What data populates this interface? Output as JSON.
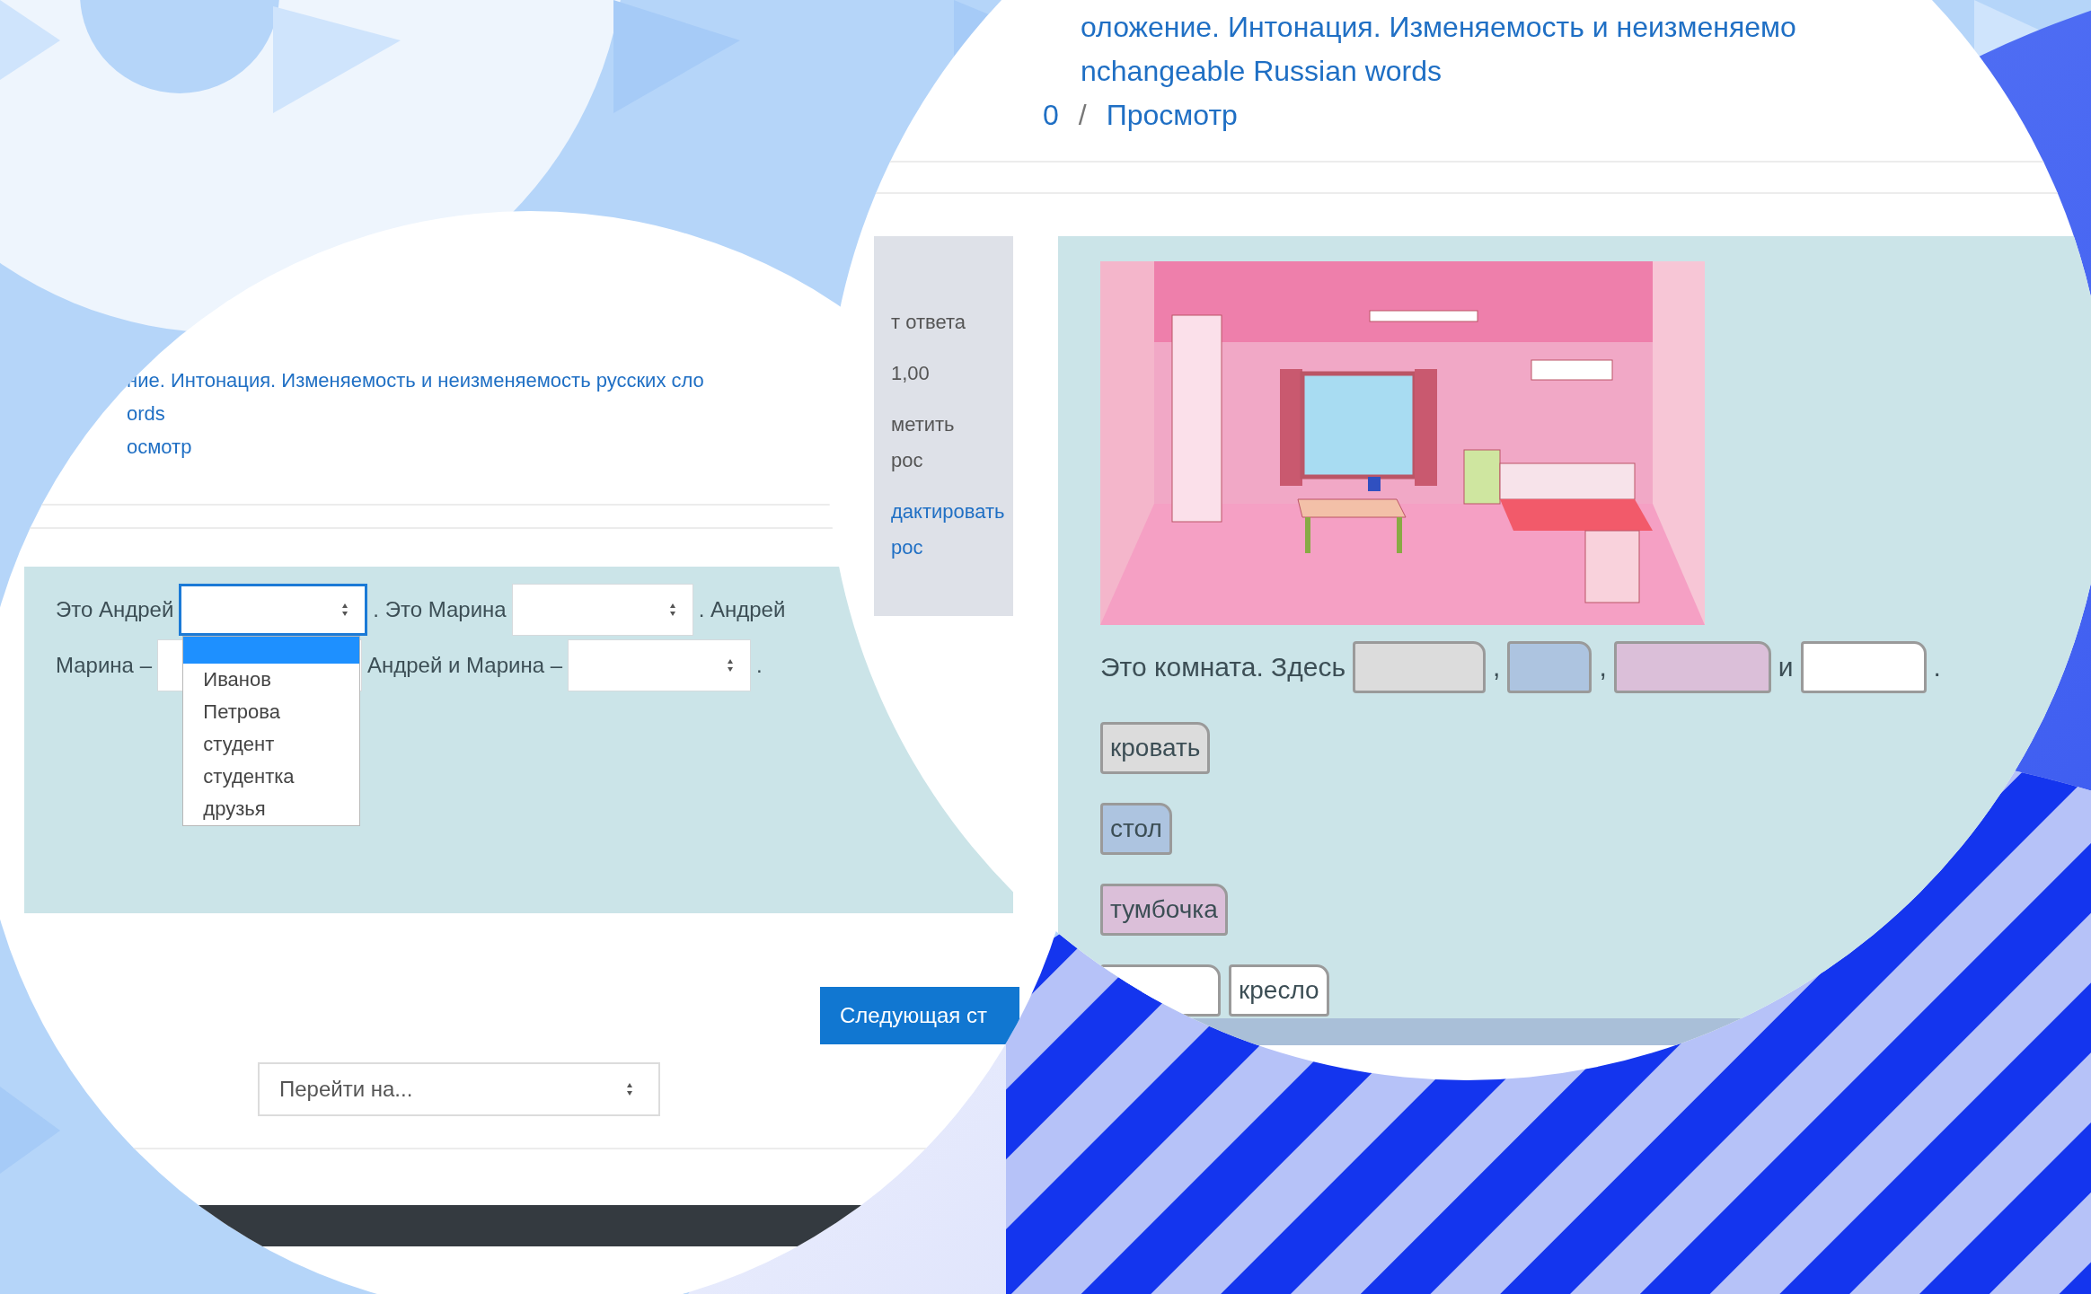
{
  "left_screen": {
    "breadcrumb": [
      "ние. Интонация. Изменяемость и неизменяемость русских сло",
      "ords",
      "осмотр"
    ],
    "question": [
      [
        {
          "kind": "text",
          "text": "Это Андрей"
        },
        {
          "kind": "select",
          "open": true
        },
        {
          "kind": "text",
          "text": ". Это Марина"
        },
        {
          "kind": "select",
          "open": false
        },
        {
          "kind": "text",
          "text": ". Андрей"
        }
      ],
      [
        {
          "kind": "text",
          "text": "Марина –"
        },
        {
          "kind": "select",
          "open": false
        },
        {
          "kind": "text",
          "text": "Андрей и Марина –"
        },
        {
          "kind": "select",
          "open": false
        },
        {
          "kind": "text",
          "text": "."
        }
      ]
    ],
    "dropdown": {
      "blank_option_highlighted": true,
      "options": [
        "Иванов",
        "Петрова",
        "студент",
        "студентка",
        "друзья"
      ]
    },
    "next_button": "Следующая ст",
    "jump_select": "Перейти на..."
  },
  "right_screen": {
    "breadcrumb": [
      "оложение. Интонация. Изменяемость и неизменяемо",
      "nchangeable Russian words"
    ],
    "path": {
      "items": [
        "0",
        "Просмотр"
      ],
      "separator": "/"
    },
    "info_box": [
      {
        "kind": "text",
        "lines": [
          "т ответа"
        ]
      },
      {
        "kind": "text",
        "lines": [
          "1,00"
        ]
      },
      {
        "kind": "text",
        "lines": [
          "метить",
          "рос"
        ]
      },
      {
        "kind": "link",
        "lines": [
          "дактировать",
          "рос"
        ]
      }
    ],
    "sentence": [
      {
        "kind": "text",
        "text": "Это комната. Здесь"
      },
      {
        "kind": "drop",
        "color": "#dcdcdc"
      },
      {
        "kind": "text",
        "text": ","
      },
      {
        "kind": "drop",
        "color": "#adc4e0"
      },
      {
        "kind": "text",
        "text": ","
      },
      {
        "kind": "drop",
        "color": "#dbbfd9"
      },
      {
        "kind": "text",
        "text": "и"
      },
      {
        "kind": "drop",
        "color": "#ffffff"
      },
      {
        "kind": "text",
        "text": "."
      }
    ],
    "drag_rows": [
      [
        {
          "text": "кровать",
          "color": "#dcdcdc"
        }
      ],
      [
        {
          "text": "стол",
          "color": "#adc4e0"
        }
      ],
      [
        {
          "text": "тумбочка",
          "color": "#dbbfd9"
        }
      ],
      [
        {
          "color": "#ffffff"
        },
        {
          "text": "кресло",
          "color": "#ffffff"
        }
      ]
    ]
  }
}
